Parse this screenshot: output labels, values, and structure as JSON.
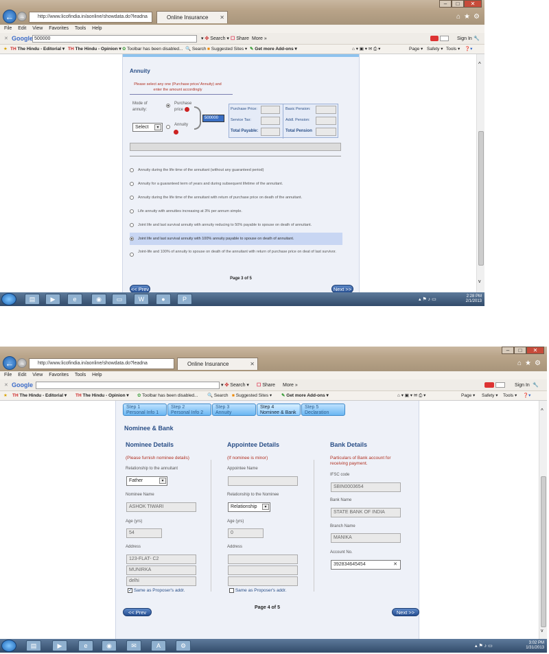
{
  "screenshot1": {
    "browser": {
      "address": "http://www.licofindia.in/aonline/showdata.do?leadna",
      "tab_title": "Online Insurance",
      "menu": [
        "File",
        "Edit",
        "View",
        "Favorites",
        "Tools",
        "Help"
      ],
      "google_label": "Google",
      "google_query": "500000",
      "search_label": "Search",
      "share_label": "Share",
      "more_label": "More »",
      "signin_label": "Sign In",
      "fav_items": [
        "The Hindu - Editorial ▾",
        "The Hindu - Opinion ▾",
        "Toolbar has been disabled...",
        "Search",
        "Suggested Sites ▾",
        "Get more Add-ons ▾"
      ],
      "cmd_items": [
        "Page ▾",
        "Safety ▾",
        "Tools ▾"
      ]
    },
    "annuity": {
      "title": "Annuity",
      "note": "Please select any one (Purchase price/ Annuity) and enter the amount accordingly",
      "mode_label": "Mode of annuity:",
      "purchase_price_label": "Purchase price",
      "annuity_label": "Annuity",
      "select_value": "Select",
      "amount_value": "500000",
      "grid_left": [
        "Purchase Price:",
        "Service Tax:",
        "Total Payable:"
      ],
      "grid_right": [
        "Basic Pension:",
        "Addl. Pension:",
        "Total Pension"
      ],
      "options": [
        "Annuity during the life time of the annuitant (without any guaranteed period)",
        "Annuity for a guaranteed term of years and during subsequent lifetime of the annuitant.",
        "Annuity during the life time of the annuitant with return of purchase price on death of the annuitant.",
        "Life annuity with annuities increasing at 3% per annum simple.",
        "Joint life and last survival annuity with annuity reducing to 50% payable to spouse on death of annuitant.",
        "Joint life and last survival annuity with 100% annuity payable to spouse on death of annuitant.",
        "Joint-life and 100% of annuity to spouse on death of the annuitant with return of purchase price on deat of last survivor."
      ],
      "selected_option": 5,
      "page": "Page 3 of 5",
      "prev": "<< Prev",
      "next": "Next >>"
    },
    "taskbar": {
      "time": "2:28 PM",
      "date": "2/1/2013"
    }
  },
  "screenshot2": {
    "browser": {
      "address": "http://www.licofindia.in/aonline/showdata.do?leadna",
      "tab_title": "Online Insurance",
      "menu": [
        "File",
        "Edit",
        "View",
        "Favorites",
        "Tools",
        "Help"
      ],
      "google_label": "Google",
      "google_query": "",
      "search_label": "Search",
      "share_label": "Share",
      "more_label": "More »",
      "signin_label": "Sign In",
      "fav_items": [
        "The Hindu - Editorial ▾",
        "The Hindu - Opinion ▾",
        "Toolbar has been disabled...",
        "Search",
        "Suggested Sites ▾",
        "Get more Add-ons ▾"
      ],
      "cmd_items": [
        "Page ▾",
        "Safety ▾",
        "Tools ▾"
      ]
    },
    "steps": [
      {
        "num": "Step 1",
        "name": "Personal Info 1"
      },
      {
        "num": "Step 2",
        "name": "Personal Info 2"
      },
      {
        "num": "Step 3",
        "name": "Annuity"
      },
      {
        "num": "Step 4",
        "name": "Nominee & Bank"
      },
      {
        "num": "Step 5",
        "name": "Declaration"
      }
    ],
    "active_step": 3,
    "section_title": "Nominee & Bank",
    "nominee": {
      "heading": "Nominee Details",
      "note": "(Please furnish nominee details)",
      "relationship_label": "Relationship to the annuitant",
      "relationship_value": "Father",
      "name_label": "Nominee Name",
      "name_value": "ASHOK TIWARI",
      "age_label": "Age (yrs)",
      "age_value": "54",
      "address_label": "Address",
      "address_lines": [
        "123-FLAT- C2",
        "MUNIRKA",
        "delhi"
      ],
      "same_addr_label": "Same as Proposer's addr.",
      "same_addr_checked": true
    },
    "appointee": {
      "heading": "Appointee Details",
      "note": "(If nominee is minor)",
      "name_label": "Appointee Name",
      "name_value": "",
      "relationship_label": "Relationship to the Nominee",
      "relationship_value": "Relationship",
      "age_label": "Age (yrs)",
      "age_value": "0",
      "address_label": "Address",
      "same_addr_label": "Same as Proposer's addr.",
      "same_addr_checked": false
    },
    "bank": {
      "heading": "Bank Details",
      "note": "Particulars of Bank account for receiving payment.",
      "ifsc_label": "IFSC code",
      "ifsc_value": "SBIN0003654",
      "bank_name_label": "Bank Name",
      "bank_name_value": "STATE BANK OF INDIA",
      "branch_label": "Branch Name",
      "branch_value": "MANIKA",
      "account_label": "Account No.",
      "account_value": "392834645454"
    },
    "page": "Page 4 of 5",
    "prev": "<< Prev",
    "next": "Next >>",
    "taskbar": {
      "time": "3:02 PM",
      "date": "1/31/2013"
    }
  }
}
